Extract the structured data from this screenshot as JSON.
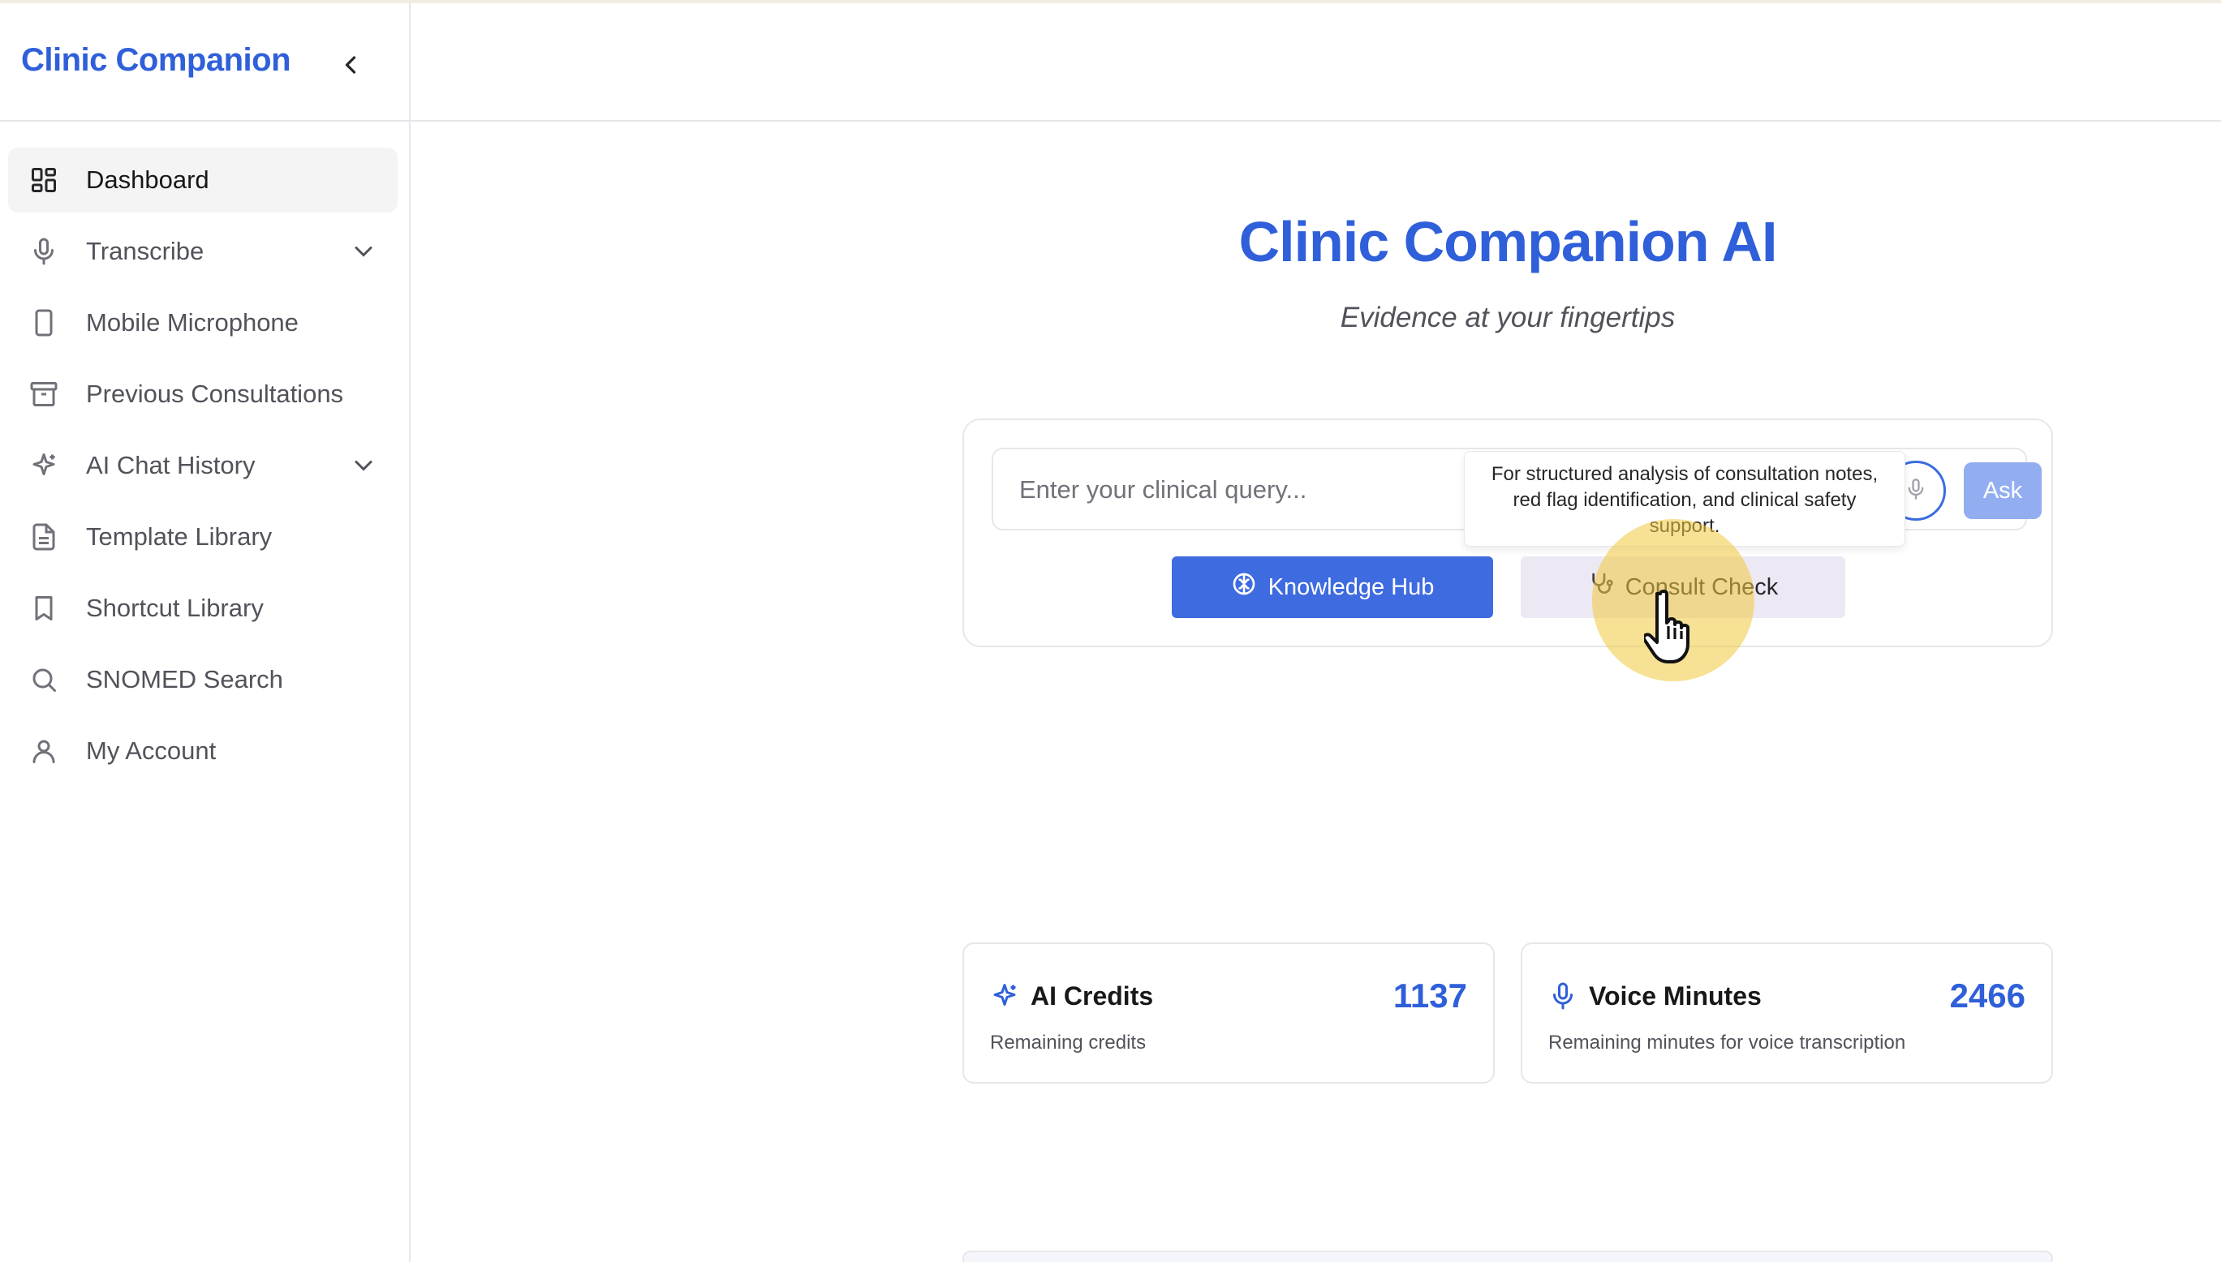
{
  "sidebar": {
    "brand": "Clinic Companion",
    "items": [
      {
        "label": "Dashboard",
        "icon": "dashboard-grid-icon",
        "active": true
      },
      {
        "label": "Transcribe",
        "icon": "microphone-icon",
        "expandable": true
      },
      {
        "label": "Mobile Microphone",
        "icon": "smartphone-icon"
      },
      {
        "label": "Previous Consultations",
        "icon": "archive-icon"
      },
      {
        "label": "AI Chat History",
        "icon": "sparkles-icon",
        "expandable": true
      },
      {
        "label": "Template Library",
        "icon": "document-icon"
      },
      {
        "label": "Shortcut Library",
        "icon": "bookmark-icon"
      },
      {
        "label": "SNOMED Search",
        "icon": "search-icon"
      },
      {
        "label": "My Account",
        "icon": "user-icon"
      }
    ]
  },
  "hero": {
    "title": "Clinic Companion AI",
    "subtitle": "Evidence at your fingertips"
  },
  "query": {
    "placeholder": "Enter your clinical query...",
    "ask_label": "Ask",
    "tooltip": "For structured analysis of consultation notes, red flag identification, and clinical safety support.",
    "knowledge_hub_label": "Knowledge Hub",
    "consult_check_label": "Consult Check"
  },
  "stats": {
    "ai_credits": {
      "title": "AI Credits",
      "value": "1137",
      "description": "Remaining credits"
    },
    "voice_minutes": {
      "title": "Voice Minutes",
      "value": "2466",
      "description": "Remaining minutes for voice transcription"
    }
  },
  "colors": {
    "brand": "#2f5fd9",
    "primary_button": "#3f6be0",
    "ask_button": "#93aef0",
    "secondary_button": "#ede9f4"
  }
}
